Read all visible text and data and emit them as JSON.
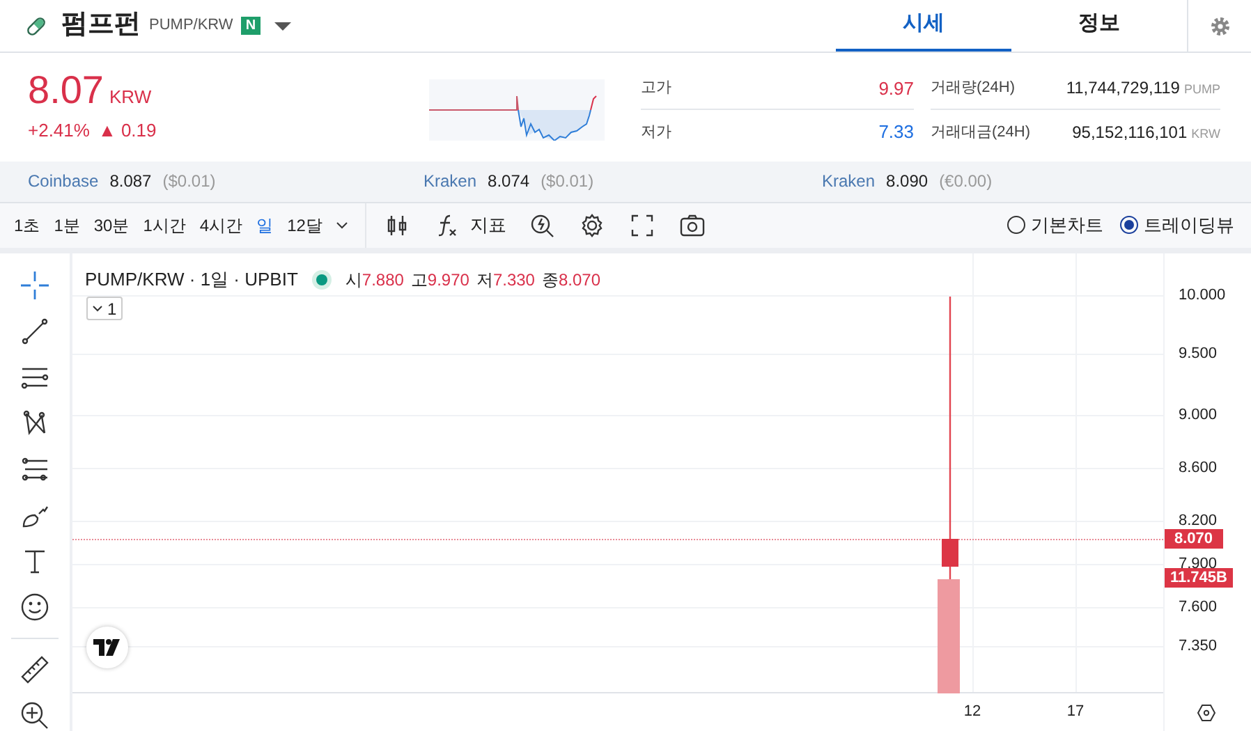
{
  "header": {
    "coin_name": "펌프펀",
    "pair": "PUMP/KRW",
    "new_badge": "N",
    "tabs": [
      {
        "label": "시세",
        "selected": true
      },
      {
        "label": "정보",
        "selected": false
      }
    ]
  },
  "price": {
    "value": "8.07",
    "currency": "KRW",
    "change_pct": "+2.41%",
    "change_arrow": "▲",
    "change_abs": "0.19"
  },
  "stats": [
    {
      "label": "고가",
      "value": "9.97",
      "kind": "high"
    },
    {
      "label": "저가",
      "value": "7.33",
      "kind": "low"
    }
  ],
  "volume": [
    {
      "label": "거래량(24H)",
      "value": "11,744,729,119",
      "unit": "PUMP"
    },
    {
      "label": "거래대금(24H)",
      "value": "95,152,116,101",
      "unit": "KRW"
    }
  ],
  "exchanges": [
    {
      "name": "Coinbase",
      "price": "8.087",
      "fx": "($0.01)"
    },
    {
      "name": "Kraken",
      "price": "8.074",
      "fx": "($0.01)"
    },
    {
      "name": "Kraken",
      "price": "8.090",
      "fx": "(€0.00)"
    }
  ],
  "toolbar": {
    "intervals": [
      {
        "label": "1초",
        "selected": false
      },
      {
        "label": "1분",
        "selected": false
      },
      {
        "label": "30분",
        "selected": false
      },
      {
        "label": "1시간",
        "selected": false
      },
      {
        "label": "4시간",
        "selected": false
      },
      {
        "label": "일",
        "selected": true
      },
      {
        "label": "12달",
        "selected": false
      }
    ],
    "indicator_label": "지표",
    "chart_types": [
      {
        "label": "기본차트",
        "selected": false
      },
      {
        "label": "트레이딩뷰",
        "selected": true
      }
    ]
  },
  "chart": {
    "symbol": "PUMP/KRW · 1일 · UPBIT",
    "ohlc": [
      {
        "label": "시",
        "value": "7.880"
      },
      {
        "label": "고",
        "value": "9.970"
      },
      {
        "label": "저",
        "value": "7.330"
      },
      {
        "label": "종",
        "value": "8.070"
      }
    ],
    "scale_button": "1",
    "price_ticks": [
      "10.000",
      "9.500",
      "9.000",
      "8.600",
      "8.200",
      "7.900",
      "7.600",
      "7.350"
    ],
    "time_ticks": [
      "12",
      "17"
    ],
    "last_price": "8.070",
    "last_volume": "11.745B"
  }
}
